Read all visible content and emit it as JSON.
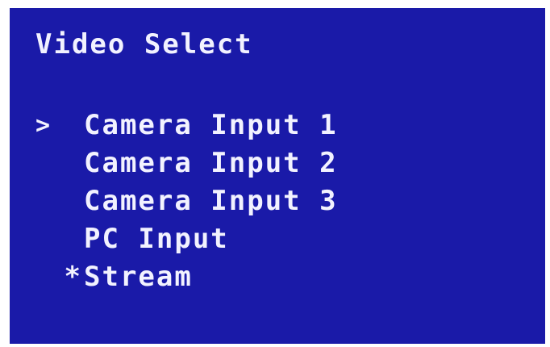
{
  "osd": {
    "title": "Video Select",
    "cursor_glyph": ">",
    "active_marker": "*",
    "background_color": "#1a1aa8",
    "text_color": "#f2f2ff",
    "items": [
      {
        "label": "Camera Input 1",
        "highlighted": true,
        "active": false
      },
      {
        "label": "Camera Input 2",
        "highlighted": false,
        "active": false
      },
      {
        "label": "Camera Input 3",
        "highlighted": false,
        "active": false
      },
      {
        "label": "PC Input",
        "highlighted": false,
        "active": false
      },
      {
        "label": "Stream",
        "highlighted": false,
        "active": true
      }
    ]
  }
}
